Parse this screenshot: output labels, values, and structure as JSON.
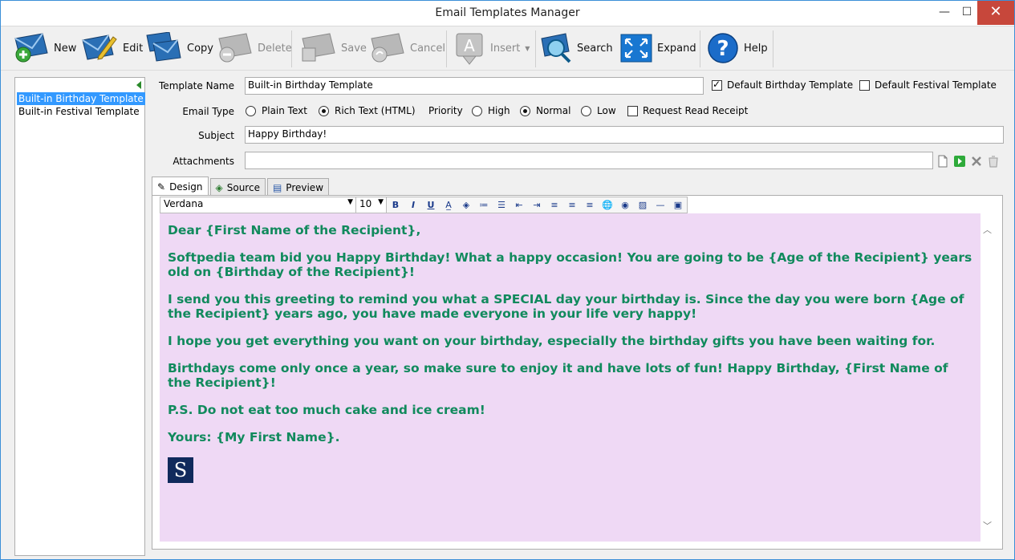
{
  "window": {
    "title": "Email Templates Manager",
    "minimize": "—",
    "maximize": "☐",
    "close": "✕"
  },
  "toolbar": {
    "new": "New",
    "edit": "Edit",
    "copy": "Copy",
    "delete": "Delete",
    "save": "Save",
    "cancel": "Cancel",
    "insert": "Insert",
    "search": "Search",
    "expand": "Expand",
    "help": "Help"
  },
  "templates": {
    "items": [
      "Built-in Birthday Template",
      "Built-in Festival Template"
    ],
    "selected": "Built-in Birthday Template"
  },
  "form": {
    "template_name_label": "Template Name",
    "template_name_value": "Built-in Birthday Template",
    "default_birthday_label": "Default Birthday Template",
    "default_birthday_checked": true,
    "default_festival_label": "Default Festival Template",
    "default_festival_checked": false,
    "email_type_label": "Email Type",
    "plain_text_label": "Plain Text",
    "rich_text_label": "Rich Text (HTML)",
    "email_type_selected": "Rich Text (HTML)",
    "priority_label": "Priority",
    "high_label": "High",
    "normal_label": "Normal",
    "low_label": "Low",
    "priority_selected": "Normal",
    "read_receipt_label": "Request Read Receipt",
    "read_receipt_checked": false,
    "subject_label": "Subject",
    "subject_value": "Happy Birthday!",
    "attachments_label": "Attachments",
    "attachments_value": ""
  },
  "tabs": {
    "design": "Design",
    "source": "Source",
    "preview": "Preview",
    "active": "Design"
  },
  "formatting": {
    "font": "Verdana",
    "size": "10",
    "bold": "B",
    "italic": "I",
    "underline": "U"
  },
  "content": {
    "paragraphs": [
      "Dear {First Name of the Recipient},",
      "Softpedia team bid you Happy Birthday! What a happy occasion! You are going to be {Age of the Recipient} years old on {Birthday of the Recipient}!",
      "I send you this greeting to remind you what a SPECIAL day your birthday is. Since the day you were born {Age of the Recipient} years ago, you have made everyone in your life very happy!",
      "I hope you get everything you want on your birthday, especially the birthday gifts you have been waiting for.",
      "Birthdays come only once a year, so make sure to enjoy it and have lots of fun! Happy Birthday, {First Name of the Recipient}!",
      "P.S. Do not eat too much cake and ice cream!",
      "Yours: {My First Name}."
    ],
    "logo_letter": "S",
    "text_color": "#118a5d",
    "background_color": "#efd9f5"
  }
}
